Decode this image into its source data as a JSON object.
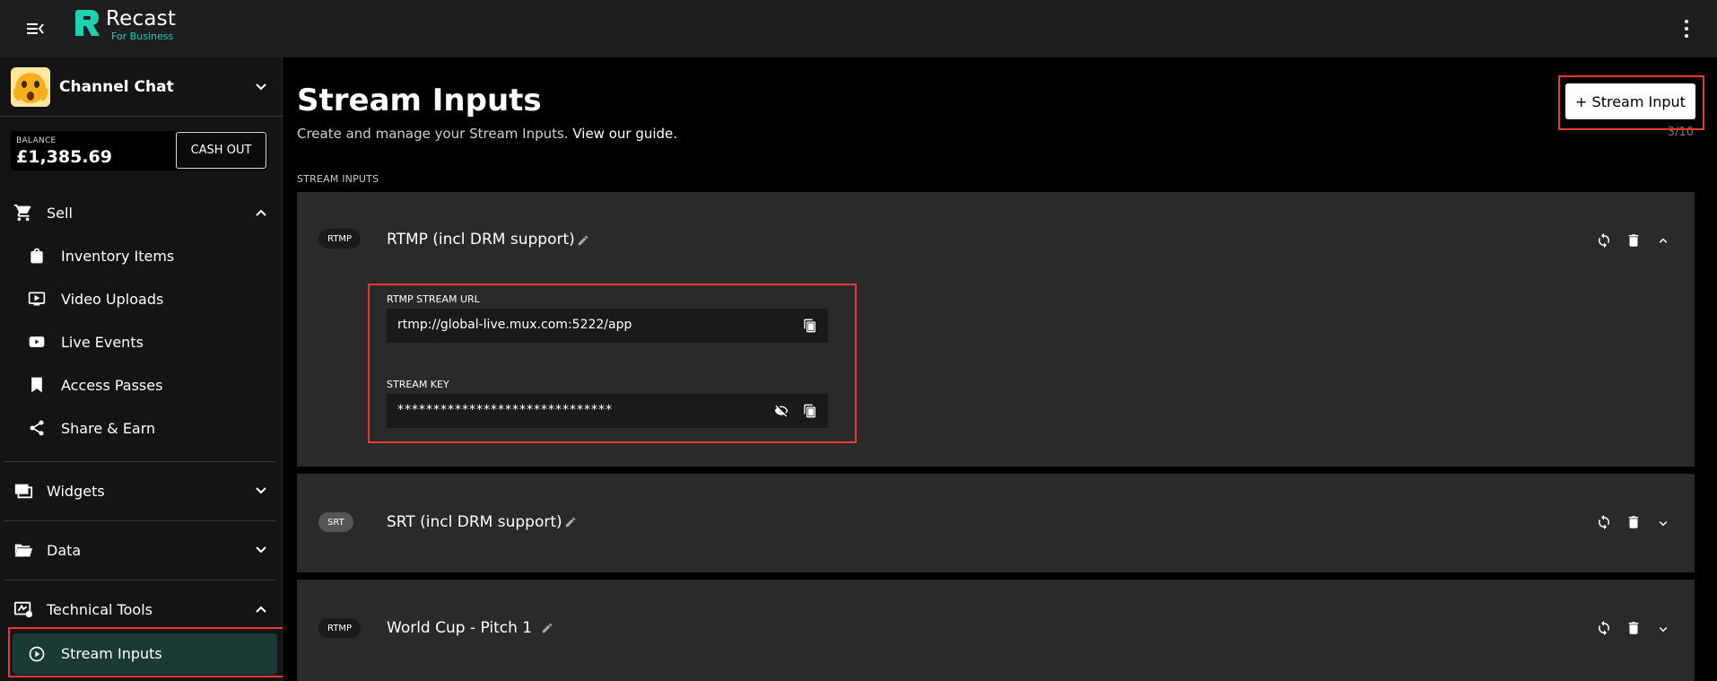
{
  "app": {
    "name": "Recast",
    "sub": "For Business",
    "brand_color": "#1ed1b0"
  },
  "icons": {
    "menu": "menu-collapse-icon",
    "more": "more-vertical-icon"
  },
  "sidebar": {
    "channel": {
      "name": "Channel Chat",
      "avatar": "shocked-emoji-avatar"
    },
    "balance": {
      "label": "BALANCE",
      "value": "£1,385.69",
      "cashout_label": "CASH OUT"
    },
    "sell": {
      "label": "Sell",
      "items": [
        {
          "label": "Inventory Items",
          "icon": "shopping-bag-icon"
        },
        {
          "label": "Video Uploads",
          "icon": "video-play-icon"
        },
        {
          "label": "Live Events",
          "icon": "youtube-icon"
        },
        {
          "label": "Access Passes",
          "icon": "ticket-icon"
        },
        {
          "label": "Share & Earn",
          "icon": "share-icon"
        }
      ]
    },
    "widgets": {
      "label": "Widgets"
    },
    "data": {
      "label": "Data"
    },
    "technical_tools": {
      "label": "Technical Tools",
      "active_item": "Stream Inputs"
    }
  },
  "main": {
    "title": "Stream Inputs",
    "subtitle": "Create and manage your Stream Inputs.",
    "guide_link": "View our guide.",
    "add_button": "+ Stream Input",
    "counter": "3/10",
    "section_label": "STREAM INPUTS",
    "inputs": [
      {
        "protocol": "RTMP",
        "name": "RTMP (incl DRM support)",
        "expanded": true,
        "url_label": "RTMP STREAM URL",
        "url": "rtmp://global-live.mux.com:5222/app",
        "key_label": "STREAM KEY",
        "key": "******************************"
      },
      {
        "protocol": "SRT",
        "name": "SRT (incl DRM support)",
        "expanded": false
      },
      {
        "protocol": "RTMP",
        "name": "World Cup - Pitch 1",
        "expanded": false
      }
    ]
  }
}
